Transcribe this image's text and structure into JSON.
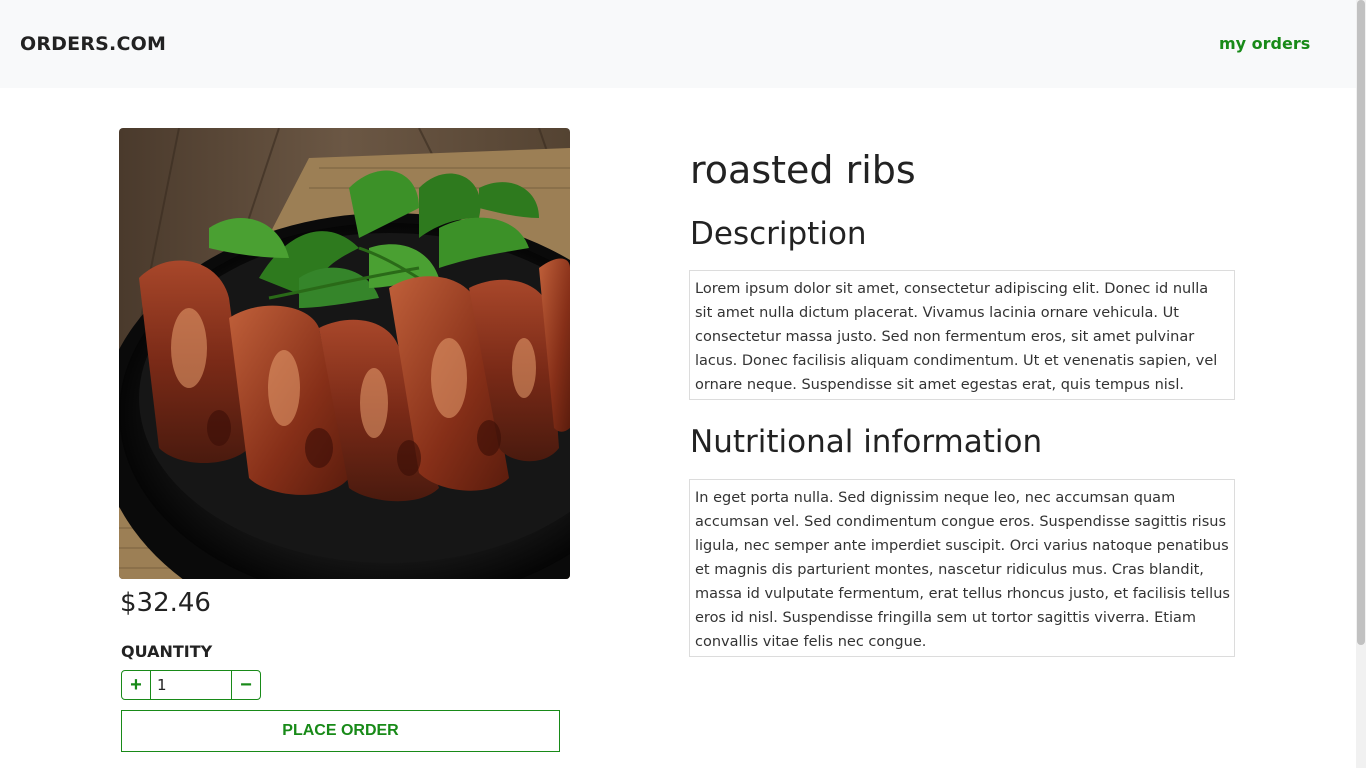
{
  "header": {
    "brand": "ORDERS.COM",
    "my_orders": "my orders"
  },
  "product": {
    "image_alt": "Roasted ribs on a cast iron pan with parsley",
    "price": "$32.46",
    "quantity_label": "QUANTITY",
    "quantity_value": "1",
    "plus_label": "+",
    "minus_label": "−",
    "order_button": "PLACE ORDER",
    "title": "roasted ribs",
    "description_heading": "Description",
    "description": "Lorem ipsum dolor sit amet, consectetur adipiscing elit. Donec id nulla sit amet nulla dictum placerat. Vivamus lacinia ornare vehicula. Ut consectetur massa justo. Sed non fermentum eros, sit amet pulvinar lacus. Donec facilisis aliquam condimentum. Ut et venenatis sapien, vel ornare neque. Suspendisse sit amet egestas erat, quis tempus nisl.",
    "nutrition_heading": "Nutritional information",
    "nutrition": "In eget porta nulla. Sed dignissim neque leo, nec accumsan quam accumsan vel. Sed condimentum congue eros. Suspendisse sagittis risus ligula, nec semper ante imperdiet suscipit. Orci varius natoque penatibus et magnis dis parturient montes, nascetur ridiculus mus. Cras blandit, massa id vulputate fermentum, erat tellus rhoncus justo, et facilisis tellus eros id nisl. Suspendisse fringilla sem ut tortor sagittis viverra. Etiam convallis vitae felis nec congue."
  },
  "colors": {
    "accent": "#188a18",
    "navbar_bg": "#f8f9fa"
  }
}
